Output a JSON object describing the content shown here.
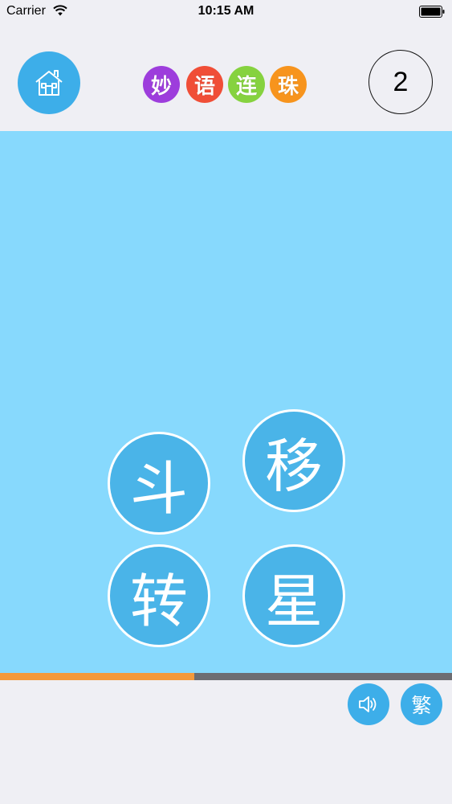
{
  "status_bar": {
    "carrier": "Carrier",
    "time": "10:15 AM",
    "icons": [
      "wifi-icon",
      "battery-icon"
    ]
  },
  "header": {
    "home_icon": "house-icon",
    "logo_chars": [
      {
        "char": "妙",
        "color": "#9d3ddc"
      },
      {
        "char": "语",
        "color": "#f04e37"
      },
      {
        "char": "连",
        "color": "#86d23f"
      },
      {
        "char": "珠",
        "color": "#f7941d"
      }
    ],
    "level": "2"
  },
  "board": {
    "background": "#87d9fd",
    "tiles": [
      "斗",
      "移",
      "转",
      "星"
    ]
  },
  "progress": {
    "value": 0.43,
    "fill_color": "#f3993b",
    "track_color": "#6d6d72"
  },
  "controls": {
    "sound_icon": "speaker-icon",
    "traditional_label": "繁"
  },
  "colors": {
    "accent": "#3daee9",
    "page_bg": "#efeff4"
  }
}
